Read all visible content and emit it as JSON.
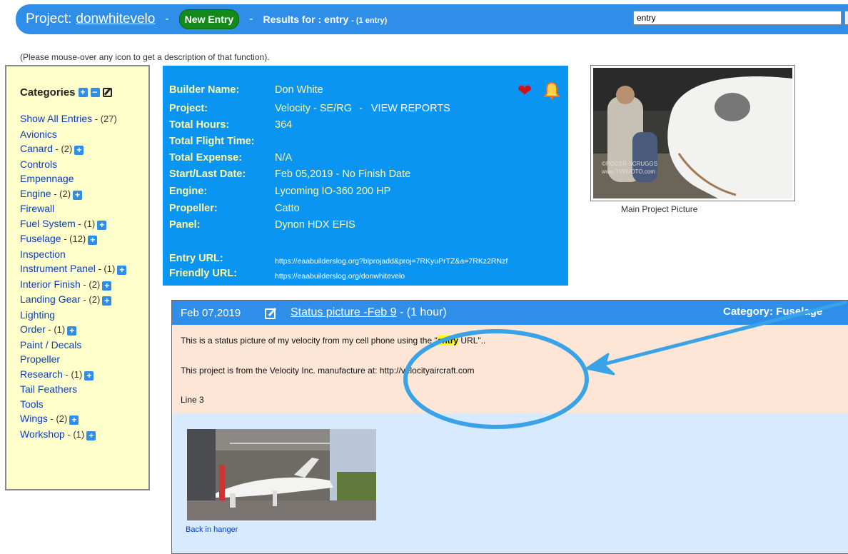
{
  "header": {
    "project_label": "Project:",
    "project_name": "donwhitevelo",
    "sep1": "-",
    "new_entry_label": "New Entry",
    "sep2": "-",
    "results_label": "Results for : entry",
    "results_count": "- (1 entry)",
    "search_value": "entry",
    "search_icon": "search-icon"
  },
  "hint": "(Please mouse-over any icon to get a description of that function).",
  "categories": {
    "title": "Categories",
    "items": [
      {
        "label": "Show All Entries",
        "count": " - (27)",
        "expand": false
      },
      {
        "label": "Avionics",
        "count": "",
        "expand": false
      },
      {
        "label": "Canard",
        "count": " - (2)",
        "expand": true
      },
      {
        "label": "Controls",
        "count": "",
        "expand": false
      },
      {
        "label": "Empennage",
        "count": "",
        "expand": false
      },
      {
        "label": "Engine",
        "count": " - (2)",
        "expand": true
      },
      {
        "label": "Firewall",
        "count": "",
        "expand": false
      },
      {
        "label": "Fuel System",
        "count": " - (1)",
        "expand": true
      },
      {
        "label": "Fuselage",
        "count": " - (12)",
        "expand": true
      },
      {
        "label": "Inspection",
        "count": "",
        "expand": false
      },
      {
        "label": "Instrument Panel",
        "count": " - (1)",
        "expand": true
      },
      {
        "label": "Interior Finish",
        "count": " - (2)",
        "expand": true
      },
      {
        "label": "Landing Gear",
        "count": " - (2)",
        "expand": true
      },
      {
        "label": "Lighting",
        "count": "",
        "expand": false
      },
      {
        "label": "Order",
        "count": " - (1)",
        "expand": true
      },
      {
        "label": "Paint / Decals",
        "count": "",
        "expand": false
      },
      {
        "label": "Propeller",
        "count": "",
        "expand": false
      },
      {
        "label": "Research",
        "count": " - (1)",
        "expand": true
      },
      {
        "label": "Tail Feathers",
        "count": "",
        "expand": false
      },
      {
        "label": "Tools",
        "count": "",
        "expand": false
      },
      {
        "label": "Wings",
        "count": " - (2)",
        "expand": true
      },
      {
        "label": "Workshop",
        "count": " - (1)",
        "expand": true
      }
    ]
  },
  "info": {
    "builder_label": "Builder Name:",
    "builder": "Don White",
    "project_label": "Project:",
    "project": "Velocity - SE/RG",
    "project_sep": "-",
    "view_reports": "VIEW REPORTS",
    "hours_label": "Total Hours:",
    "hours": "364",
    "flight_label": "Total Flight Time:",
    "flight": "",
    "expense_label": "Total Expense:",
    "expense": "N/A",
    "dates_label": "Start/Last Date:",
    "dates": "Feb 05,2019 - No Finish Date",
    "engine_label": "Engine:",
    "engine": "Lycoming IO-360 200 HP",
    "propeller_label": "Propeller:",
    "propeller": "Catto",
    "panel_label": "Panel:",
    "panel": "Dynon HDX EFIS",
    "entry_url_label": "Entry URL:",
    "entry_url": "https://eaabuilderslog.org?blprojadd&proj=7RKyuPrTZ&a=7RKz2RNzf",
    "friendly_url_label": "Friendly URL:",
    "friendly_url": "https://eaabuilderslog.org/donwhitevelo"
  },
  "main_picture": {
    "caption": "Main Project Picture",
    "watermark_1": "©ROGER SCRUGGS",
    "watermark_2": "www.TVPHOTO.com"
  },
  "entry": {
    "date": "Feb 07,2019",
    "title": "Status picture -Feb 9",
    "duration": " - (1 hour)",
    "category": "Category: Fuselage",
    "line1_pre": "This is a status picture of my velocity from my cell phone using the \"",
    "line1_hl": "entry",
    "line1_post": " URL\"..",
    "line2": "This project is from the Velocity Inc. manufacture at: http://velocityaircraft.com",
    "line3": "Line 3",
    "photo_caption": "Back in hanger"
  },
  "colors": {
    "header_blue": "#2f8ee8",
    "info_blue": "#0b95f2",
    "sidebar_bg": "#ffffcc",
    "entry_body_bg": "#fde6d6",
    "annotation": "#3aa3e8"
  }
}
